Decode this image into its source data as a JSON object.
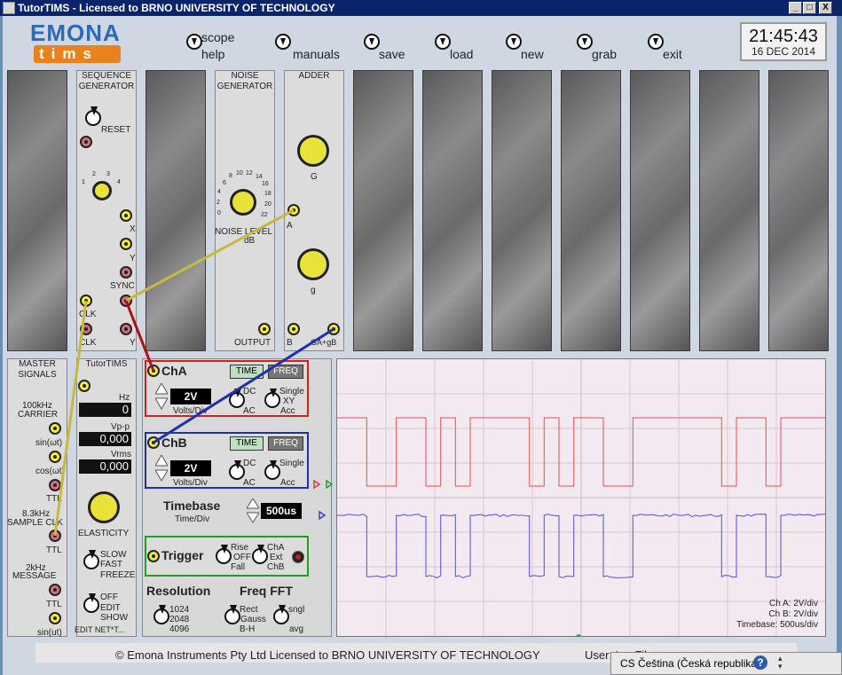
{
  "titlebar": {
    "title": "TutorTIMS - Licensed to BRNO UNIVERSITY OF TECHNOLOGY",
    "minimize": "_",
    "maximize": "□",
    "close": "X"
  },
  "logo": {
    "line1": "EMONA",
    "line2": "tims"
  },
  "toolbar": {
    "scope": "scope",
    "help": "help",
    "manuals": "manuals",
    "save": "save",
    "load": "load",
    "new": "new",
    "grab": "grab",
    "exit": "exit"
  },
  "clock": {
    "time": "21:45:43",
    "date": "16 DEC 2014"
  },
  "sequence_generator": {
    "title1": "SEQUENCE",
    "title2": "GENERATOR",
    "reset": "RESET",
    "x": "X",
    "y": "Y",
    "sync": "SYNC",
    "clk": "CLK",
    "clk2": "CLK",
    "y2": "Y",
    "dial": [
      "1",
      "2",
      "3",
      "4"
    ]
  },
  "noise_generator": {
    "title1": "NOISE",
    "title2": "GENERATOR",
    "level": "NOISE LEVEL",
    "db": "dB",
    "output": "OUTPUT",
    "dial": [
      "0",
      "2",
      "4",
      "6",
      "8",
      "10",
      "12",
      "14",
      "16",
      "18",
      "20",
      "22"
    ]
  },
  "adder": {
    "title": "ADDER",
    "g_upper": "G",
    "a": "A",
    "g_lower": "g",
    "b": "B",
    "out": "GA+gB"
  },
  "master": {
    "title1": "MASTER",
    "title2": "SIGNALS",
    "carrier1": "100kHz",
    "carrier2": "CARRIER",
    "sin": "sin(ωt)",
    "cos": "cos(ωt)",
    "ttl1": "TTL",
    "sample1": "8.3kHz",
    "sample2": "SAMPLE CLK",
    "ttl2": "TTL",
    "msg1": "2kHz",
    "msg2": "MESSAGE",
    "ttl3": "TTL",
    "sin2": "sin(ut)"
  },
  "tutortims": {
    "title": "TutorTIMS",
    "hz": "Hz",
    "hz_value": "0",
    "vpp": "Vp-p",
    "vpp_value": "0,000",
    "vrms": "Vrms",
    "vrms_value": "0,000",
    "elasticity": "ELASTICITY",
    "slow": "SLOW",
    "fast": "FAST",
    "freeze": "FREEZE",
    "off": "OFF",
    "edit": "EDIT",
    "show": "SHOW",
    "editnet": "EDIT NET*T..."
  },
  "cha": {
    "label": "ChA",
    "time": "TIME",
    "freq": "FREQ",
    "volts": "2V",
    "voltsdiv": "Volts/Div",
    "dc": "DC",
    "ac": "AC",
    "single": "Single",
    "xy": "XY",
    "acc": "Acc"
  },
  "chb": {
    "label": "ChB",
    "time": "TIME",
    "freq": "FREQ",
    "volts": "2V",
    "voltsdiv": "Volts/Div",
    "dc": "DC",
    "ac": "AC",
    "single": "Single",
    "acc": "Acc"
  },
  "timebase": {
    "label": "Timebase",
    "sub": "Time/Div",
    "value": "500us"
  },
  "trigger": {
    "label": "Trigger",
    "rise": "Rise",
    "off": "OFF",
    "fall": "Fall",
    "cha": "ChA",
    "ext": "Ext",
    "chb": "ChB"
  },
  "resolution": {
    "label": "Resolution",
    "r1": "1024",
    "r2": "2048",
    "r3": "4096"
  },
  "fft": {
    "label": "Freq FFT",
    "rect": "Rect",
    "gauss": "Gauss",
    "bh": "B-H",
    "sngl": "sngl",
    "avg": "avg"
  },
  "scope_info": {
    "cha": "Ch A: 2V/div",
    "chb": "Ch B: 2V/div",
    "timebase": "Timebase: 500us/div"
  },
  "footer": {
    "copyright": "© Emona Instruments Pty Ltd Licensed to BRNO UNIVERSITY OF TECHNOLOGY",
    "user": "User: L.   . File: ..."
  },
  "langbar": {
    "text": "CS Čeština (Česká republika)",
    "help": "?"
  },
  "colors": {
    "cha_trace": "#e05050",
    "chb_trace": "#5050e0",
    "wire_yellow": "#c8b840",
    "wire_red": "#b01010",
    "wire_blue": "#2030b0"
  },
  "traces": {
    "cha_bits": [
      1,
      1,
      0,
      0,
      1,
      1,
      0,
      1,
      0,
      1,
      1,
      1,
      1,
      0,
      1,
      0,
      1,
      1,
      0,
      0,
      1,
      1,
      1,
      1,
      1,
      1,
      0,
      1,
      1,
      0,
      1,
      1,
      1
    ],
    "chb_bits": [
      1,
      1,
      0,
      0,
      1,
      1,
      0,
      1,
      0,
      1,
      1,
      1,
      1,
      0,
      1,
      0,
      1,
      1,
      0,
      0,
      1,
      1,
      1,
      1,
      1,
      1,
      0,
      1,
      1,
      0,
      1,
      1,
      1
    ]
  }
}
